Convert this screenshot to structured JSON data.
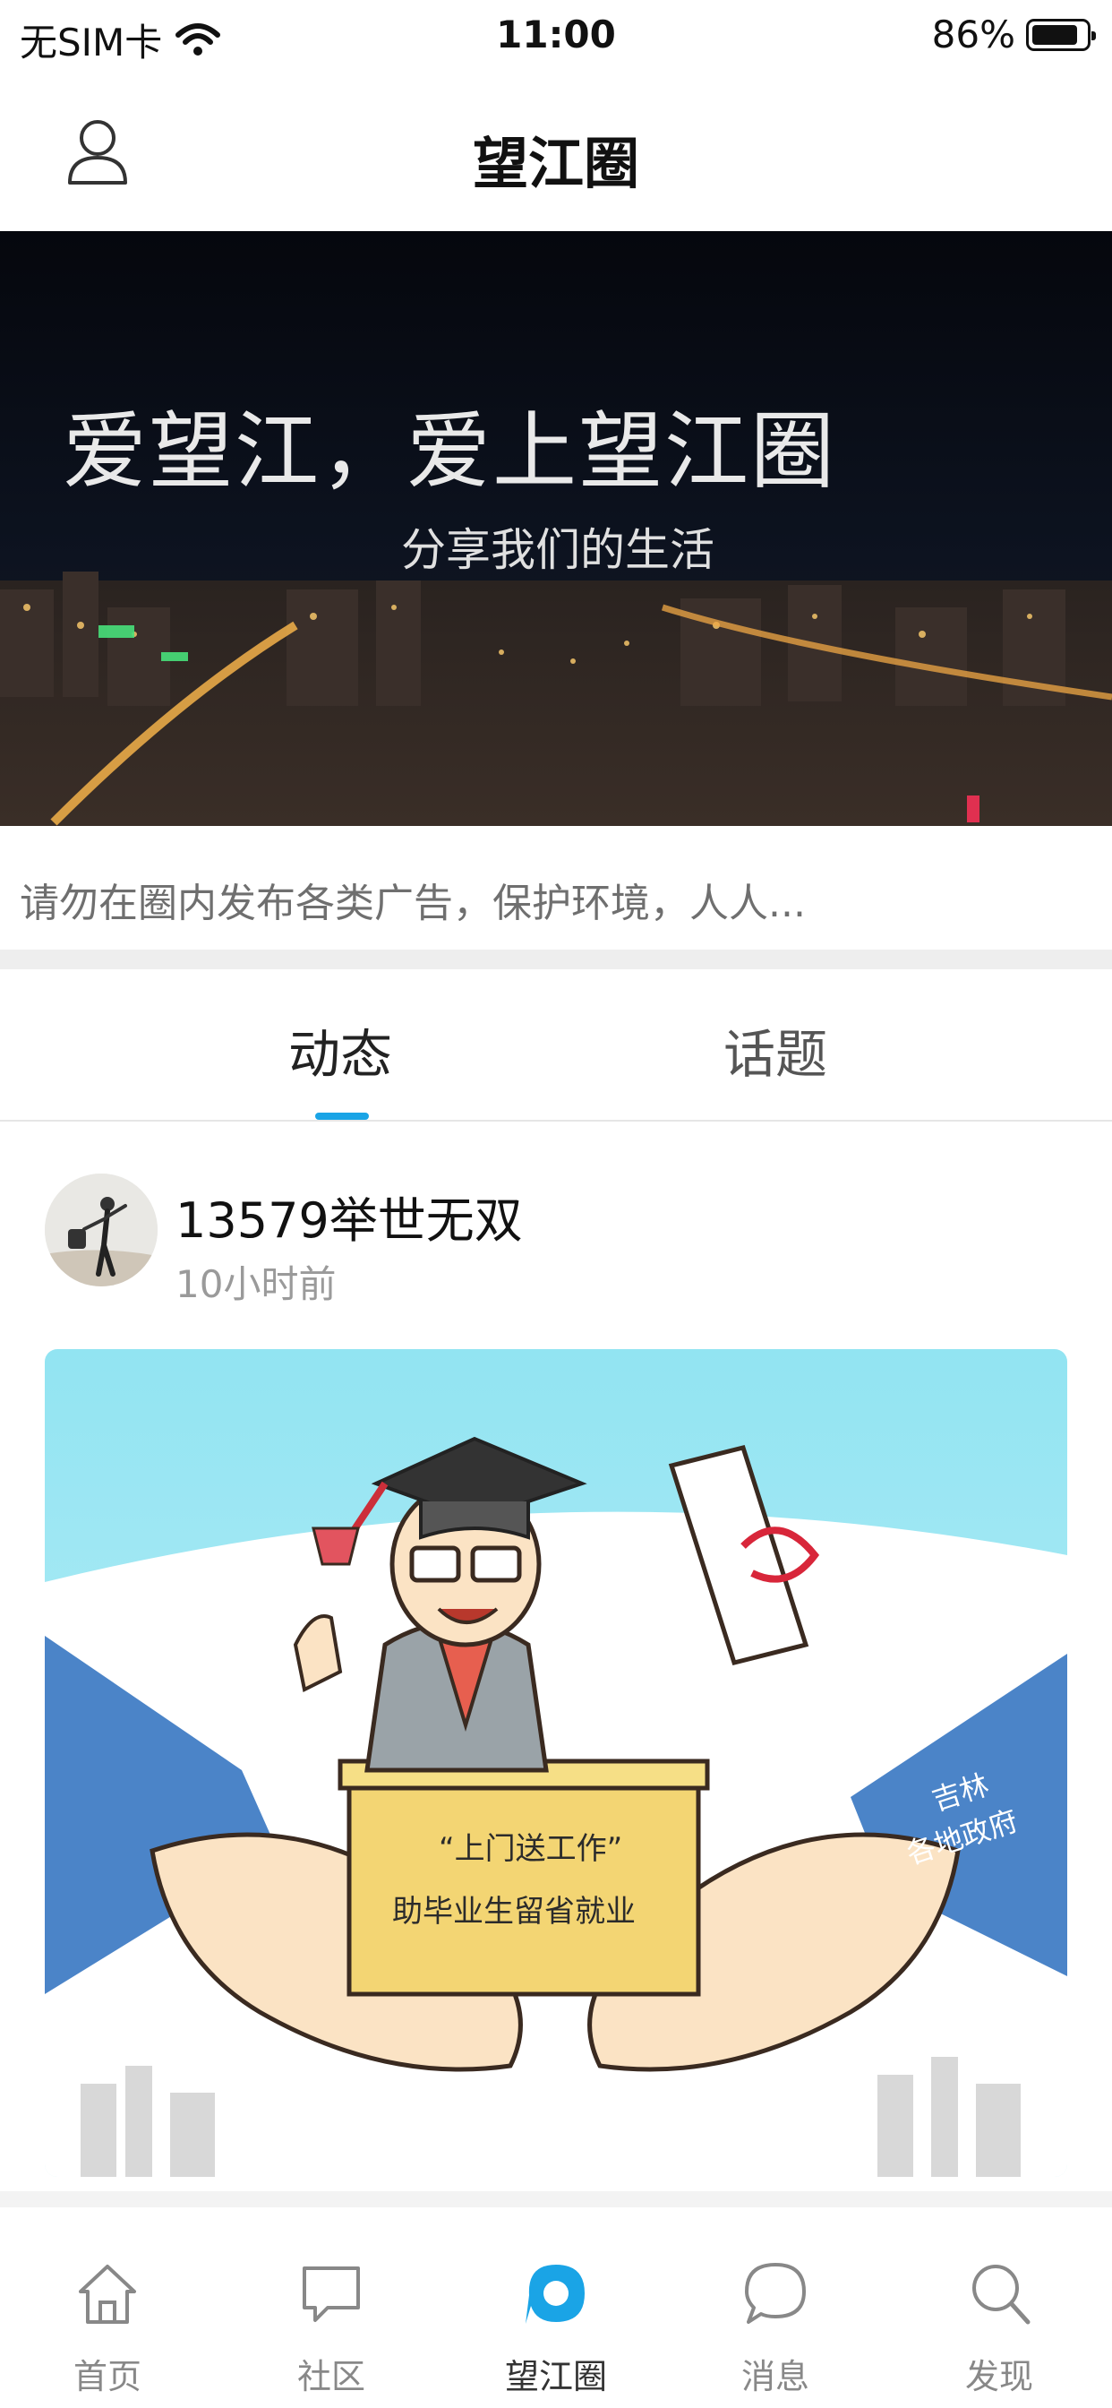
{
  "status_bar": {
    "carrier": "无SIM卡",
    "time": "11:00",
    "battery_text": "86%",
    "battery_level": 0.86
  },
  "nav": {
    "title": "望江圈",
    "profile_icon": "user-icon"
  },
  "banner": {
    "title": "爱望江，爱上望江圈",
    "subtitle": "分享我们的生活"
  },
  "notice": {
    "text": "请勿在圈内发布各类广告，保护环境，人人..."
  },
  "tabs": [
    {
      "label": "动态",
      "active": true
    },
    {
      "label": "话题",
      "active": false
    }
  ],
  "post": {
    "username": "13579举世无双",
    "time": "10小时前",
    "image_texts": {
      "box_line1": "“上门送工作”",
      "box_line2": "助毕业生留省就业",
      "sleeve_line1": "吉林",
      "sleeve_line2": "各地政府"
    }
  },
  "tabbar": [
    {
      "label": "首页",
      "icon": "home-icon",
      "active": false
    },
    {
      "label": "社区",
      "icon": "chat-square-icon",
      "active": false
    },
    {
      "label": "望江圈",
      "icon": "circle-icon",
      "active": true
    },
    {
      "label": "消息",
      "icon": "message-bubble-icon",
      "active": false
    },
    {
      "label": "发现",
      "icon": "search-icon",
      "active": false
    }
  ],
  "colors": {
    "accent": "#1aa4e6",
    "inactive_tab": "#888888"
  }
}
